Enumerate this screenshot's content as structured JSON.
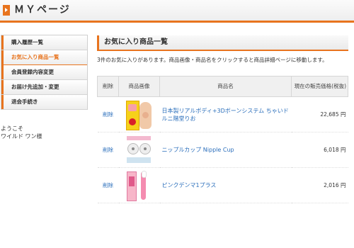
{
  "header": {
    "title": "ＭＹページ"
  },
  "sidebar": {
    "items": [
      {
        "label": "購入履歴一覧"
      },
      {
        "label": "お気に入り商品一覧"
      },
      {
        "label": "会員登録内容変更"
      },
      {
        "label": "お届け先追加・変更"
      },
      {
        "label": "退会手続き"
      }
    ],
    "active_index": 1
  },
  "welcome": {
    "line1": "ようこそ",
    "line2": "ワイルド ワン様"
  },
  "main": {
    "section_title": "お気に入り商品一覧",
    "notice": "3件のお気に入りがあります。商品画像・商品名をクリックすると商品詳細ページに移動します。",
    "table": {
      "headers": {
        "delete": "削除",
        "image": "商品画像",
        "name": "商品名",
        "price": "現在の販売価格(税抜)"
      },
      "rows": [
        {
          "delete": "削除",
          "name": "日本製リアルボディ+3Dボーンシステム ちゃいドルニ階堂りお",
          "price": "22,685 円"
        },
        {
          "delete": "削除",
          "name": "ニップルカップ Nipple Cup",
          "price": "6,018 円"
        },
        {
          "delete": "削除",
          "name": "ピンクデンマ1プラス",
          "price": "2,016 円"
        }
      ]
    }
  },
  "colors": {
    "accent": "#e8741e",
    "link": "#2a6ebb"
  }
}
